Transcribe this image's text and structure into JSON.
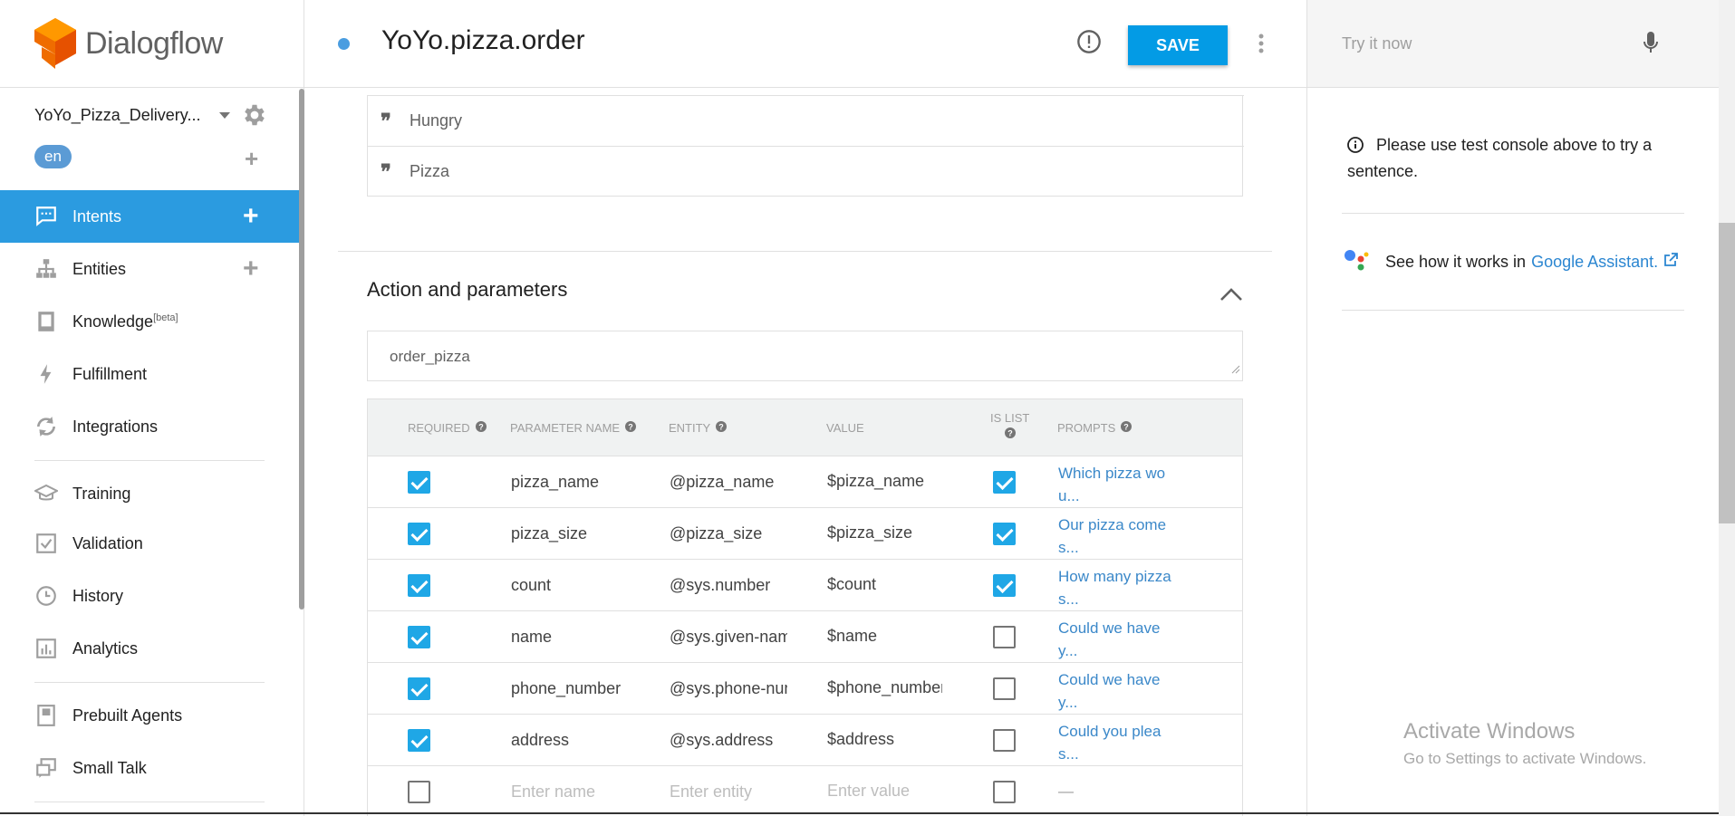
{
  "sidebar": {
    "brand": "Dialogflow",
    "agent_name": "YoYo_Pizza_Delivery...",
    "language": "en",
    "nav": [
      {
        "label": "Intents",
        "active": true,
        "icon": "chat-bubble-icon"
      },
      {
        "label": "Entities",
        "icon": "hierarchy-icon"
      },
      {
        "label": "Knowledge",
        "sup": "[beta]",
        "icon": "book-icon"
      },
      {
        "label": "Fulfillment",
        "icon": "bolt-icon"
      },
      {
        "label": "Integrations",
        "icon": "sync-icon"
      },
      {
        "label": "Training",
        "icon": "graduation-cap-icon"
      },
      {
        "label": "Validation",
        "icon": "check-box-icon"
      },
      {
        "label": "History",
        "icon": "clock-icon"
      },
      {
        "label": "Analytics",
        "icon": "bar-chart-icon"
      },
      {
        "label": "Prebuilt Agents",
        "icon": "agent-book-icon"
      },
      {
        "label": "Small Talk",
        "icon": "chat-window-icon"
      }
    ]
  },
  "header": {
    "title": "YoYo.pizza.order",
    "save_label": "SAVE"
  },
  "main": {
    "phrases": [
      "Hungry",
      "Pizza"
    ],
    "section_title": "Action and parameters",
    "action_name": "order_pizza",
    "table": {
      "headers": {
        "required": "REQUIRED",
        "parameter_name": "PARAMETER NAME",
        "entity": "ENTITY",
        "value": "VALUE",
        "is_list": "IS LIST",
        "prompts": "PROMPTS"
      },
      "rows": [
        {
          "required": true,
          "name": "pizza_name",
          "entity": "@pizza_name",
          "value": "$pizza_name",
          "is_list": true,
          "prompt_1": "Which pizza wo",
          "prompt_2": "u..."
        },
        {
          "required": true,
          "name": "pizza_size",
          "entity": "@pizza_size",
          "value": "$pizza_size",
          "is_list": true,
          "prompt_1": "Our pizza come",
          "prompt_2": "s..."
        },
        {
          "required": true,
          "name": "count",
          "entity": "@sys.number",
          "value": "$count",
          "is_list": true,
          "prompt_1": "How many pizza",
          "prompt_2": "s..."
        },
        {
          "required": true,
          "name": "name",
          "entity": "@sys.given-name",
          "value": "$name",
          "is_list": false,
          "prompt_1": "Could we have",
          "prompt_2": "y..."
        },
        {
          "required": true,
          "name": "phone_number",
          "entity": "@sys.phone-number",
          "value": "$phone_number",
          "is_list": false,
          "prompt_1": "Could we have",
          "prompt_2": "y..."
        },
        {
          "required": true,
          "name": "address",
          "entity": "@sys.address",
          "value": "$address",
          "is_list": false,
          "prompt_1": "Could you plea",
          "prompt_2": "s..."
        }
      ],
      "new_row": {
        "name_placeholder": "Enter name",
        "entity_placeholder": "Enter entity",
        "value_placeholder": "Enter value",
        "prompt": "—"
      }
    }
  },
  "right_panel": {
    "try_placeholder": "Try it now",
    "info_text": "Please use test console above to try a sentence.",
    "ga_text": "See how it works in",
    "ga_link": "Google Assistant."
  },
  "watermark": {
    "title": "Activate Windows",
    "subtitle": "Go to Settings to activate Windows."
  },
  "colors": {
    "accent": "#039be5",
    "active_nav": "#2b9be0",
    "checkbox": "#1fa7e6",
    "link": "#3b88c9"
  }
}
